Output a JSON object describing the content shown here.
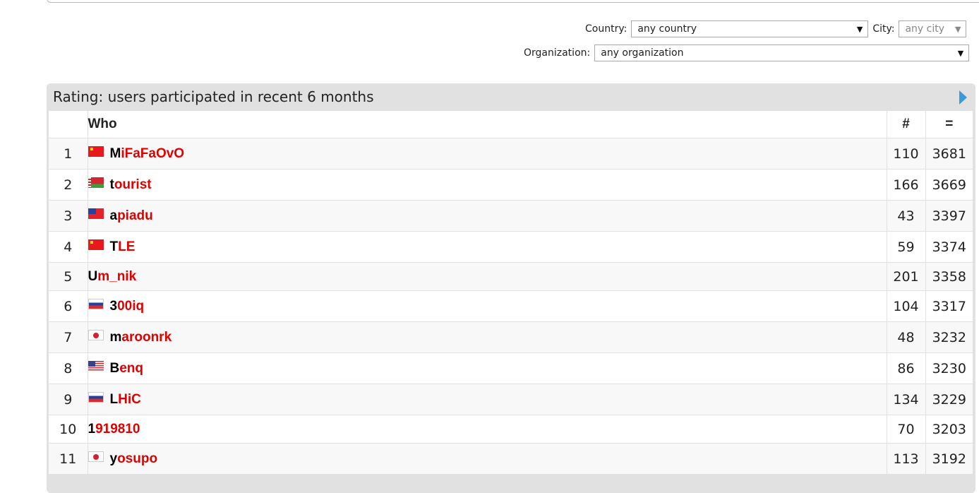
{
  "filters": {
    "country_label": "Country:",
    "country_value": "any country",
    "city_label": "City:",
    "city_value": "any city",
    "organization_label": "Organization:",
    "organization_value": "any organization"
  },
  "rating": {
    "title": "Rating: users participated in recent 6 months",
    "columns": {
      "who": "Who",
      "contests": "#",
      "rating": "="
    },
    "rows": [
      {
        "rank": "1",
        "flag": "china-flag-icon",
        "first": "M",
        "rest": "iFaFaOvO",
        "contests": "110",
        "rating": "3681"
      },
      {
        "rank": "2",
        "flag": "belarus-flag-icon",
        "first": "t",
        "rest": "ourist",
        "contests": "166",
        "rating": "3669"
      },
      {
        "rank": "3",
        "flag": "samoa-flag-icon",
        "first": "a",
        "rest": "piadu",
        "contests": "43",
        "rating": "3397"
      },
      {
        "rank": "4",
        "flag": "china-flag-icon",
        "first": "T",
        "rest": "LE",
        "contests": "59",
        "rating": "3374"
      },
      {
        "rank": "5",
        "flag": "",
        "first": "U",
        "rest": "m_nik",
        "contests": "201",
        "rating": "3358"
      },
      {
        "rank": "6",
        "flag": "russia-flag-icon",
        "first": "3",
        "rest": "00iq",
        "contests": "104",
        "rating": "3317"
      },
      {
        "rank": "7",
        "flag": "japan-flag-icon",
        "first": "m",
        "rest": "aroonrk",
        "contests": "48",
        "rating": "3232"
      },
      {
        "rank": "8",
        "flag": "usa-flag-icon",
        "first": "B",
        "rest": "enq",
        "contests": "86",
        "rating": "3230"
      },
      {
        "rank": "9",
        "flag": "russia-flag-icon",
        "first": "L",
        "rest": "HiC",
        "contests": "134",
        "rating": "3229"
      },
      {
        "rank": "10",
        "flag": "",
        "first": "1",
        "rest": "919810",
        "contests": "70",
        "rating": "3203"
      },
      {
        "rank": "11",
        "flag": "japan-flag-icon",
        "first": "y",
        "rest": "osupo",
        "contests": "113",
        "rating": "3192"
      }
    ]
  },
  "colors": {
    "legendary_red": "#e00000",
    "panel_grey": "#e1e1e1",
    "arrow_blue": "#3b9ad9"
  }
}
